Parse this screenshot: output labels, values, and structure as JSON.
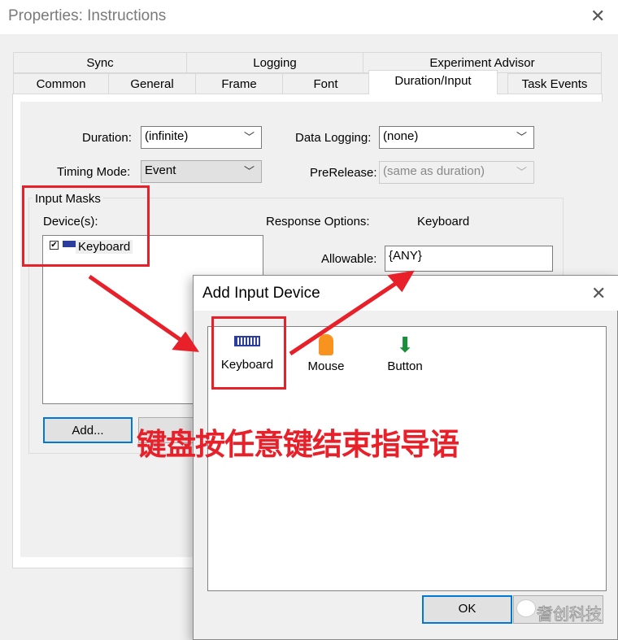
{
  "window": {
    "title": "Properties: Instructions",
    "close_icon": "close-icon"
  },
  "tabs_row1": [
    "Sync",
    "Logging",
    "Experiment Advisor"
  ],
  "tabs_row2": [
    "Common",
    "General",
    "Frame",
    "Font",
    "Duration/Input",
    "Task Events"
  ],
  "active_tab": "Duration/Input",
  "form": {
    "duration_label": "Duration:",
    "duration_value": "(infinite)",
    "timing_label": "Timing Mode:",
    "timing_value": "Event",
    "logging_label": "Data Logging:",
    "logging_value": "(none)",
    "prerelease_label": "PreRelease:",
    "prerelease_value": "(same as duration)"
  },
  "input_masks": {
    "group_label": "Input Masks",
    "devices_label": "Device(s):",
    "devices": [
      {
        "name": "Keyboard",
        "checked": true
      }
    ],
    "response_label": "Response Options:",
    "response_device": "Keyboard",
    "allowable_label": "Allowable:",
    "allowable_value": "{ANY}",
    "add_button": "Add..."
  },
  "dialog": {
    "title": "Add Input Device",
    "devices": [
      {
        "name": "Keyboard",
        "icon": "keyboard-icon"
      },
      {
        "name": "Mouse",
        "icon": "mouse-icon"
      },
      {
        "name": "Button",
        "icon": "button-download-icon"
      }
    ],
    "ok_button": "OK"
  },
  "annotation": "键盘按任意键结束指导语",
  "watermark": "耆创科技",
  "colors": {
    "annotation": "#e8202a",
    "focus": "#0078d7"
  }
}
